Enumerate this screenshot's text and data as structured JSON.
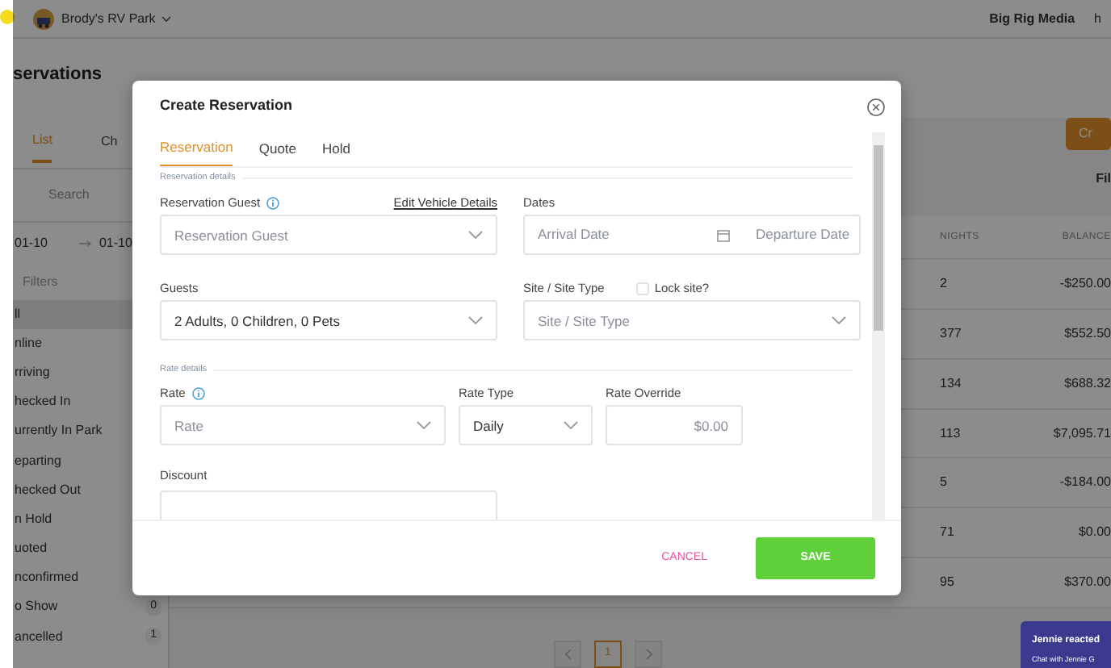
{
  "top_bar": {
    "park_name": "Brody's RV Park",
    "company": "Big Rig Media",
    "user": "h"
  },
  "page": {
    "title": "servations",
    "create_button": "Cr",
    "filter_label": "Fil"
  },
  "sidebar": {
    "tabs": [
      {
        "label": "List",
        "selected": true
      },
      {
        "label": "Ch",
        "selected": false
      }
    ],
    "search": {
      "placeholder": "Search"
    },
    "date_from": "01-10",
    "date_to": "01-10",
    "filters_label": "Filters",
    "status_filters": [
      {
        "label": "ll",
        "selected": true
      },
      {
        "label": "nline",
        "selected": false
      },
      {
        "label": "rriving",
        "selected": false
      },
      {
        "label": "hecked In",
        "selected": false
      },
      {
        "label": "urrently In Park",
        "selected": false
      },
      {
        "label": "eparting",
        "selected": false
      },
      {
        "label": "hecked Out",
        "selected": false
      },
      {
        "label": "n Hold",
        "selected": false
      },
      {
        "label": "uoted",
        "selected": false
      },
      {
        "label": "nconfirmed",
        "selected": false
      },
      {
        "label": "o Show",
        "count": "0",
        "selected": false
      },
      {
        "label": "ancelled",
        "count": "1",
        "selected": false
      }
    ]
  },
  "table": {
    "columns": [
      "NIGHTS",
      "BALANCE"
    ],
    "rows": [
      {
        "nights": "2",
        "balance": "-$250.00"
      },
      {
        "nights": "377",
        "balance": "$552.50"
      },
      {
        "nights": "134",
        "balance": "$688.32"
      },
      {
        "nights": "113",
        "balance": "$7,095.71"
      },
      {
        "nights": "5",
        "balance": "-$184.00"
      },
      {
        "nights": "71",
        "balance": "$0.00"
      },
      {
        "nights": "95",
        "balance": "$370.00"
      }
    ]
  },
  "pagination": {
    "pages": [
      {
        "label": "1",
        "selected": true
      }
    ]
  },
  "modal": {
    "title": "Create Reservation",
    "tabs": [
      {
        "label": "Reservation",
        "selected": true
      },
      {
        "label": "Quote",
        "selected": false
      },
      {
        "label": "Hold",
        "selected": false
      }
    ],
    "reservation_details_label": "Reservation details",
    "guest": {
      "label": "Reservation Guest",
      "placeholder": "Reservation Guest"
    },
    "edit_vehicle_link": "Edit Vehicle Details",
    "dates": {
      "label": "Dates",
      "arrival_placeholder": "Arrival Date",
      "departure_placeholder": "Departure Date"
    },
    "guests": {
      "label": "Guests",
      "value": "2 Adults, 0 Children, 0 Pets"
    },
    "site": {
      "label": "Site / Site Type",
      "placeholder": "Site / Site Type",
      "lock_label": "Lock site?",
      "lock_checked": false
    },
    "rate_details_label": "Rate details",
    "rate": {
      "label": "Rate",
      "placeholder": "Rate"
    },
    "rate_type": {
      "label": "Rate Type",
      "value": "Daily"
    },
    "rate_override": {
      "label": "Rate Override",
      "placeholder": "$0.00"
    },
    "discount": {
      "label": "Discount"
    },
    "cancel_button": "CANCEL",
    "save_button": "SAVE"
  },
  "chat_popup": {
    "title": "Jennie reacted",
    "subtitle": "Chat with Jennie G"
  }
}
